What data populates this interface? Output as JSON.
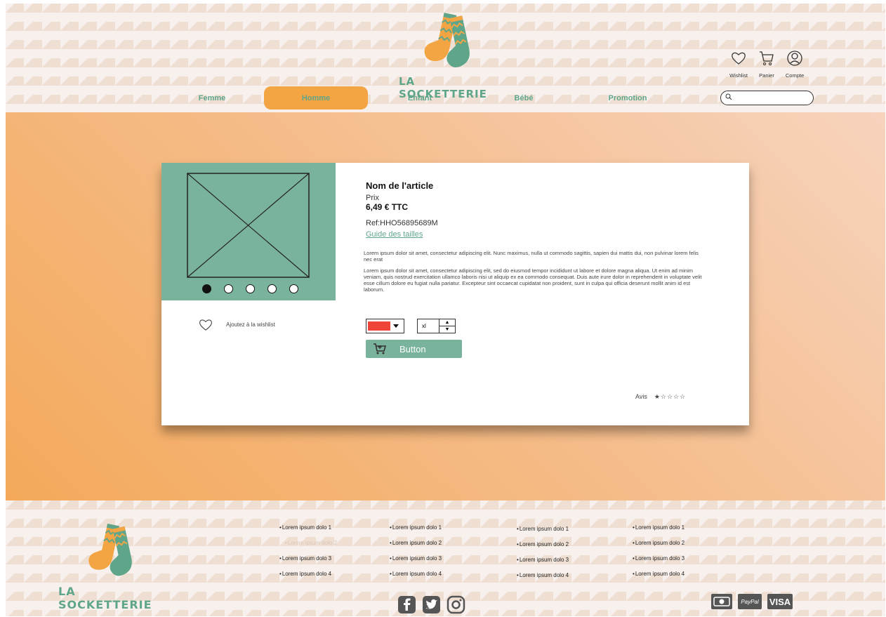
{
  "brand": {
    "name": "LA SOCKETTERIE"
  },
  "header": {
    "nav": [
      {
        "label": "Femme",
        "active": false
      },
      {
        "label": "Homme",
        "active": true
      },
      {
        "label": "Enfant",
        "active": false
      },
      {
        "label": "Bébé",
        "active": false
      },
      {
        "label": "Promotion",
        "active": false
      }
    ],
    "icons": [
      {
        "name": "heart-icon",
        "label": "Wishlist"
      },
      {
        "name": "cart-icon",
        "label": "Panier"
      },
      {
        "name": "user-icon",
        "label": "Compte"
      }
    ],
    "search": {
      "placeholder": ""
    }
  },
  "product": {
    "title": "Nom de l'article",
    "price_label": "Prix",
    "price": "6,49 € TTC",
    "ref": "Ref:HHO56895689M",
    "size_guide": "Guide des tailles",
    "desc1": "Lorem ipsum dolor sit amet, consectetur adipiscing elit. Nunc maximus, nulla ut commodo sagittis, sapien dui mattis dui, non pulvinar lorem felis nec erat",
    "desc2": "Lorem ipsum dolor sit amet, consectetur adipiscing elit, sed do eiusmod tempor incididunt ut labore et dolore magna aliqua. Ut enim ad minim veniam, quis nostrud exercitation ullamco laboris nisi ut aliquip ex ea commodo consequat. Duis aute irure dolor in reprehenderit in voluptate velit esse cillum dolore eu fugiat nulla pariatur. Excepteur sint occaecat cupidatat non proident, sunt in culpa qui officia deserunt mollit anim id est laborum.",
    "wishlist_label": "Ajoutez à la wishlist",
    "color": "#f04438",
    "size": "xl",
    "button_label": "Button",
    "reviews_label": "Avis",
    "rating": 1,
    "rating_max": 5,
    "carousel_count": 5,
    "carousel_active": 1
  },
  "footer": {
    "col1": [
      "Lorem ipsum dolo 1",
      "Lorem ipsum dolo 2",
      "Lorem ipsum dolo 3",
      "Lorem ipsum dolo 4"
    ],
    "col2": [
      "Lorem ipsum dolo 1",
      "Lorem ipsum dolo 2",
      "Lorem ipsum dolo 3",
      "Lorem ipsum dolo 4"
    ],
    "col3": [
      "Lorem ipsum dolo 1",
      "Lorem ipsum dolo 2",
      "Lorem ipsum dolo 3",
      "Lorem ipsum dolo 4"
    ],
    "col4": [
      "Lorem ipsum dolo 1",
      "Lorem ipsum dolo 2",
      "Lorem ipsum dolo 3",
      "Lorem ipsum dolo 4"
    ],
    "social": [
      "facebook-icon",
      "twitter-icon",
      "instagram-icon"
    ],
    "payments": {
      "cash": "cash-icon",
      "paypal": "PayPal",
      "visa": "VISA"
    }
  },
  "colors": {
    "green": "#7ab39b",
    "orange": "#f4a543",
    "text_green": "#5fa58a"
  }
}
